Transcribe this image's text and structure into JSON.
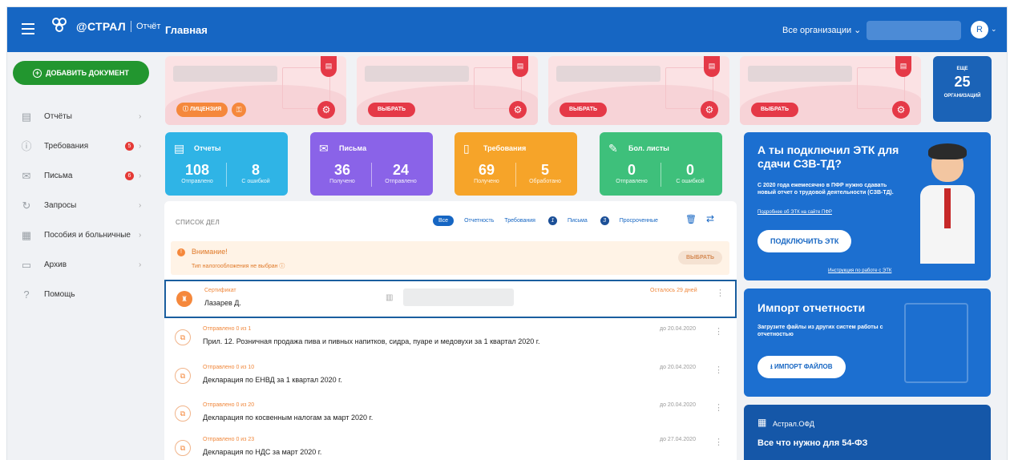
{
  "app": {
    "logo_brand": "@СТРАЛ",
    "logo_sub": "Отчёт",
    "page_title": "Главная",
    "orgs_label": "Все организации ⌄",
    "avatar_letter": "R"
  },
  "sidebar": {
    "add_label": "ДОБАВИТЬ ДОКУМЕНТ",
    "items": [
      {
        "label": "Отчёты",
        "icon": "reports-icon",
        "badge": ""
      },
      {
        "label": "Требования",
        "icon": "requirements-icon",
        "badge": "5"
      },
      {
        "label": "Письма",
        "icon": "mail-icon",
        "badge": "6"
      },
      {
        "label": "Запросы",
        "icon": "requests-icon",
        "badge": ""
      },
      {
        "label": "Пособия и больничные",
        "icon": "benefits-icon",
        "badge": ""
      },
      {
        "label": "Архив",
        "icon": "archive-icon",
        "badge": ""
      },
      {
        "label": "Помощь",
        "icon": "help-icon",
        "badge": ""
      }
    ]
  },
  "org_cards": {
    "license_label": "ЛИЦЕНЗИЯ",
    "pick_label": "ВЫБРАТЬ",
    "more_top": "ЕЩЕ",
    "more_count": "25",
    "more_bottom": "ОРГАНИЗАЦИЙ"
  },
  "tiles": [
    {
      "title": "Отчеты",
      "n1": "108",
      "c1": "Отправлено",
      "n2": "8",
      "c2": "С ошибкой",
      "color": "#2fb4e6"
    },
    {
      "title": "Письма",
      "n1": "36",
      "c1": "Получено",
      "n2": "24",
      "c2": "Отправлено",
      "color": "#8a63e8"
    },
    {
      "title": "Требования",
      "n1": "69",
      "c1": "Получено",
      "n2": "5",
      "c2": "Обработано",
      "color": "#f6a429"
    },
    {
      "title": "Бол. листы",
      "n1": "0",
      "c1": "Отправлено",
      "n2": "0",
      "c2": "С ошибкой",
      "color": "#3ec07b"
    }
  ],
  "tasks": {
    "header": "СПИСОК ДЕЛ",
    "filters": {
      "all": "Все",
      "reporting": "Отчетность",
      "requirements": "Требования",
      "requirements_count": "1",
      "letters": "Письма",
      "letters_count": "3",
      "overdue": "Просроченные"
    },
    "warning": {
      "title": "Внимание!",
      "subtitle": "Тип налогообложения не выбран ⓘ",
      "button": "ВЫБРАТЬ"
    },
    "rows": [
      {
        "status": "Сертификат",
        "title": "Лазарев Д.",
        "date": "Осталось 29 дней"
      },
      {
        "status": "Отправлено 0 из 1",
        "title": "Прил. 12. Розничная продажа пива и пивных напитков, сидра, пуаре и медовухи за 1 квартал 2020 г.",
        "date": "до 20.04.2020"
      },
      {
        "status": "Отправлено 0 из 10",
        "title": "Декларация по ЕНВД за 1 квартал 2020 г.",
        "date": "до 20.04.2020"
      },
      {
        "status": "Отправлено 0 из 20",
        "title": "Декларация по косвенным налогам за март 2020 г.",
        "date": "до 20.04.2020"
      },
      {
        "status": "Отправлено 0 из 23",
        "title": "Декларация по НДС за март 2020 г.",
        "date": "до 27.04.2020"
      }
    ]
  },
  "promo": {
    "title": "А ты подключил ЭТК для сдачи СЗВ-ТД?",
    "desc": "С 2020 года ежемесячно в ПФР нужно сдавать новый отчет о трудовой деятельности (СЗВ-ТД).",
    "link": "Подробнее об ЭТК на сайте ПФР",
    "button": "ПОДКЛЮЧИТЬ ЭТК",
    "instr": "Инструкция по работе с ЭТК"
  },
  "import": {
    "title": "Импорт отчетности",
    "desc": "Загрузите файлы из других систем работы с отчетностью",
    "button": "ИМПОРТ ФАЙЛОВ"
  },
  "ofd": {
    "name": "Астрал.ОФД",
    "title": "Все что нужно для 54-ФЗ"
  }
}
